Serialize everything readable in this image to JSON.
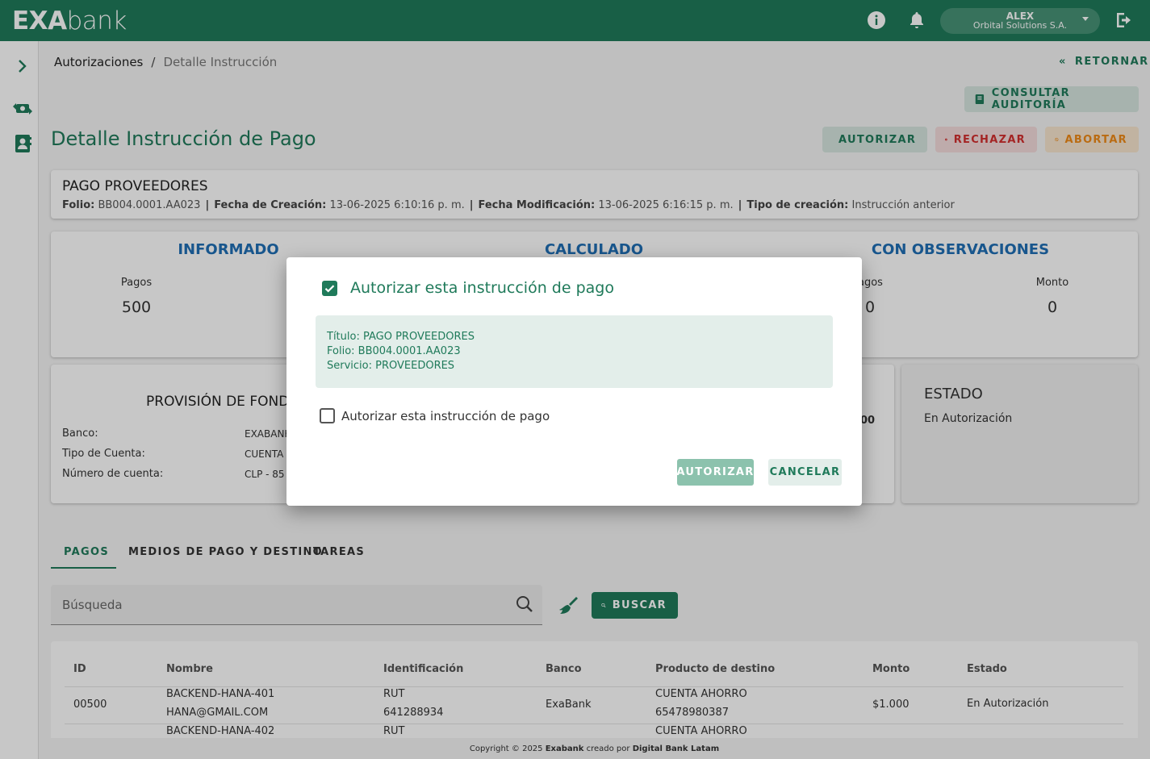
{
  "header": {
    "logo_exa": "EXA",
    "logo_bank": "bank",
    "user_name": "ALEX",
    "user_org": "Orbital Solutions S.A."
  },
  "breadcrumb": {
    "first": "Autorizaciones",
    "separator": "/",
    "second": "Detalle Instrucción"
  },
  "actions": {
    "retornar": "RETORNAR",
    "consultar": "CONSULTAR AUDITORÍA",
    "autorizar": "AUTORIZAR",
    "rechazar": "RECHAZAR",
    "abortar": "ABORTAR"
  },
  "page_title": "Detalle Instrucción de Pago",
  "payment": {
    "title": "PAGO PROVEEDORES",
    "folio_label": "Folio:",
    "folio": "BB004.0001.AA023",
    "fecha_creacion_label": "Fecha de Creación:",
    "fecha_creacion": "13-06-2025 6:10:16 p. m.",
    "fecha_mod_label": "Fecha Modificación:",
    "fecha_mod": "13-06-2025 6:16:15 p. m.",
    "tipo_label": "Tipo de creación:",
    "tipo": "Instrucción anterior",
    "sep": "|"
  },
  "summary": {
    "informado": "INFORMADO",
    "calculado": "CALCULADO",
    "observaciones": "CON OBSERVACIONES",
    "pagos_label": "Pagos",
    "pagos_value": "500",
    "obs_pagos_label_partial": "agos",
    "obs_pagos_value": "0",
    "monto_label": "Monto",
    "monto_value": "0"
  },
  "provision": {
    "title_partial": "PROVISIÓN DE FOND",
    "banco_label": "Banco:",
    "banco_partial": "EXABANK",
    "tipo_label": "Tipo de Cuenta:",
    "tipo_partial": "CUENTA",
    "numero_label": "Número de cuenta:",
    "numero_partial": "CLP - 85",
    "peek_partial": "00"
  },
  "estado": {
    "title": "ESTADO",
    "value": "En Autorización"
  },
  "tabs": [
    "PAGOS",
    "MEDIOS DE PAGO Y DESTINO",
    "TAREAS"
  ],
  "search": {
    "placeholder": "Búsqueda",
    "buscar": "BUSCAR"
  },
  "table": {
    "headers": [
      "ID",
      "Nombre",
      "Identificación",
      "Banco",
      "Producto de destino",
      "Monto",
      "Estado"
    ],
    "rows": [
      {
        "id": "00500",
        "nombre1": "BACKEND-HANA-401",
        "nombre2": "HANA@GMAIL.COM",
        "ident1": "RUT",
        "ident2": "641288934",
        "banco": "ExaBank",
        "producto1": "CUENTA AHORRO",
        "producto2": "65478980387",
        "monto": "$1.000",
        "estado": "En Autorización"
      },
      {
        "nombre1": "BACKEND-HANA-402",
        "ident1": "RUT",
        "producto1": "CUENTA AHORRO"
      }
    ]
  },
  "footer": {
    "copyright": "Copyright © 2025 ",
    "brand": "Exabank",
    "mid": " creado por ",
    "company": "Digital Bank Latam"
  },
  "dialog": {
    "title": "Autorizar esta instrucción de pago",
    "titulo_line": "Título: PAGO PROVEEDORES",
    "folio_line": "Folio: BB004.0001.AA023",
    "servicio_line": "Servicio: PROVEEDORES",
    "checkbox_label": "Autorizar esta instrucción de pago",
    "confirm": "AUTORIZAR",
    "cancel": "CANCELAR"
  },
  "colors": {
    "brand": "#1f7a5a",
    "info_blue": "#1f6fb5",
    "danger": "#d32f2f",
    "warning": "#ef8a17"
  }
}
